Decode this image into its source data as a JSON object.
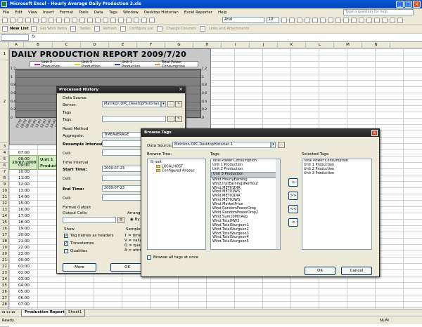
{
  "app": {
    "title": "Microsoft Excel - Hourly Average Daily Production 3.xls",
    "ask_placeholder": "Type a question for help"
  },
  "menu": [
    "File",
    "Edit",
    "View",
    "Insert",
    "Format",
    "Tools",
    "Data",
    "Tags",
    "Window",
    "Desktop Historian",
    "Excel Reporter",
    "Help"
  ],
  "toolbar": {
    "font": "Arial",
    "size": "10",
    "new_list": "New List",
    "items": [
      "Get Work Items",
      "Tables",
      "Refresh",
      "Configure List",
      "Change Columns",
      "Links and Attachments"
    ]
  },
  "columns": [
    "A",
    "B",
    "C",
    "D",
    "E",
    "F",
    "G",
    "H",
    "I",
    "J",
    "K",
    "L",
    "M",
    "N"
  ],
  "report": {
    "title": "DAILY PRODUCTION REPORT 2009/7/20",
    "date": "20/07/2009",
    "col_b": "Unit 1 Product",
    "legend": [
      {
        "name": "Unit 2 Production",
        "color": "#c020c0"
      },
      {
        "name": "Unit 3 Production",
        "color": "#e0e000"
      },
      {
        "name": "Unit 1 Production",
        "color": "#2040c0"
      },
      {
        "name": "Total Power Consumption",
        "color": "#ff9020"
      }
    ],
    "yticks": [
      "1.2",
      "1",
      "0.8",
      "0.6",
      "0.4",
      "0.2",
      "0"
    ],
    "xticks": [
      "07:00",
      "08:00",
      "09:00",
      "10:00",
      "11:00",
      "12:00",
      "13:00",
      "14:00",
      "15:00",
      "16:00"
    ]
  },
  "rows": [
    {
      "n": "1",
      "t": ""
    },
    {
      "n": "2",
      "t": ""
    },
    {
      "n": "3",
      "t": ""
    },
    {
      "n": "4",
      "t": "07:00"
    },
    {
      "n": "5",
      "t": "08:00"
    },
    {
      "n": "6",
      "t": "09:00"
    },
    {
      "n": "7",
      "t": "10:00"
    },
    {
      "n": "8",
      "t": "11:00"
    },
    {
      "n": "9",
      "t": "12:00"
    },
    {
      "n": "10",
      "t": "13:00"
    },
    {
      "n": "11",
      "t": "14:00"
    },
    {
      "n": "12",
      "t": "15:00"
    },
    {
      "n": "13",
      "t": "16:00"
    },
    {
      "n": "14",
      "t": "17:00"
    },
    {
      "n": "15",
      "t": "18:00"
    },
    {
      "n": "16",
      "t": "19:00"
    },
    {
      "n": "17",
      "t": "20:00"
    },
    {
      "n": "18",
      "t": "21:00"
    },
    {
      "n": "19",
      "t": "22:00"
    },
    {
      "n": "20",
      "t": "23:00"
    },
    {
      "n": "21",
      "t": "00:00"
    },
    {
      "n": "22",
      "t": "01:00"
    },
    {
      "n": "23",
      "t": "02:00"
    },
    {
      "n": "24",
      "t": "03:00"
    },
    {
      "n": "25",
      "t": "04:00"
    },
    {
      "n": "26",
      "t": "05:00"
    },
    {
      "n": "27",
      "t": "06:00"
    },
    {
      "n": "28",
      "t": "07:00"
    },
    {
      "n": "29",
      "t": ""
    },
    {
      "n": "30",
      "t": ""
    },
    {
      "n": "31",
      "t": ""
    }
  ],
  "sheets": [
    "Production Report",
    "Sheet1"
  ],
  "status": {
    "left": "Ready",
    "right": "NUM"
  },
  "processed_history": {
    "title": "Processed History",
    "data_source": "Data Source",
    "server_label": "Server:",
    "server_value": "Matrikon.OPC.DesktopHistorian.1",
    "tags": "Tags",
    "tags_label": "Tags:",
    "read_method": "Read Method",
    "aggregate_label": "Aggregate:",
    "aggregate_value": "TIMEAVERAGE",
    "resample_label": "Resample Interval:",
    "resample_value": "60",
    "cell_label": "Cell:",
    "time_interval": "Time Interval",
    "start_label": "Start Time:",
    "start_value": "2009-07-23",
    "end_label": "End Time:",
    "end_value": "2009-07-23",
    "format_output": "Format Output",
    "output_cells": "Output Cells:",
    "arrange": "Arrange",
    "by_col": "By col",
    "show": "Show",
    "tag_headers": "Tag names as headers",
    "timestamps": "Timestamps",
    "qualities": "Qualities",
    "sample": "Sample",
    "sample_lines": [
      "T = timest",
      "V = value",
      "Q = qualit",
      "A = attribu"
    ],
    "more_button": "More",
    "ok_button": "OK"
  },
  "browse_tags": {
    "title": "Browse Tags",
    "ds_label": "Data Source:",
    "ds_value": "Matrikon.OPC.DesktopHistorian.1",
    "tree_label": "Browse Tree:",
    "tags_label": "Tags:",
    "selected_label": "Selected Tags:",
    "tree": [
      "root",
      "LOCALHOST",
      "Configured Aliases"
    ],
    "tags": [
      "Total Power Consumption",
      "Unit 1 Production",
      "Unit 2 Production",
      "Unit 3 Production",
      "Wind.HourlyEarning",
      "Wind.InstEarningsPerHour",
      "Wind.MET01DIR",
      "Wind.MET01WS",
      "Wind.MET02DIR",
      "Wind.MET02WS",
      "Wind.MarketPrice",
      "Wind.RandomPowerDrop",
      "Wind.RandomPowerDrop2",
      "Wind.Sum10MinAvg",
      "Wind.TotalMW3",
      "Wind.TotalSturgeon1",
      "Wind.TotalSturgeon2",
      "Wind.TotalSturgeon3",
      "Wind.TotalSturgeon4",
      "Wind.TotalSturgeon5"
    ],
    "selected": [
      "Total Power Consumption",
      "Unit 1 Production",
      "Unit 2 Production",
      "Unit 3 Production"
    ],
    "buttons": [
      ">",
      ">>",
      "<<",
      "<"
    ],
    "browse_all": "Browse all tags at once",
    "ok": "OK",
    "cancel": "Cancel"
  }
}
